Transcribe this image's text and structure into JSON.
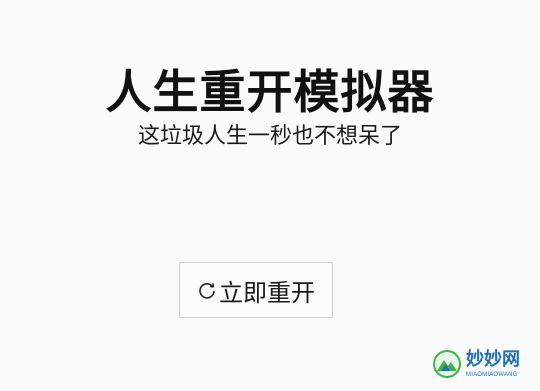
{
  "header": {
    "title": "人生重开模拟器",
    "subtitle": "这垃圾人生一秒也不想呆了"
  },
  "main": {
    "restart_button": {
      "label": "立即重开",
      "icon": "restart-icon"
    }
  },
  "watermark": {
    "name": "妙妙网",
    "sub": "MIAOMIAOWANG",
    "logo_icon": "mountain-logo-icon"
  },
  "colors": {
    "background": "#fafafa",
    "text": "#111111",
    "button_border": "#cfcfcf",
    "watermark_blue": "#1f6fb3",
    "watermark_green": "#3fb24a"
  }
}
